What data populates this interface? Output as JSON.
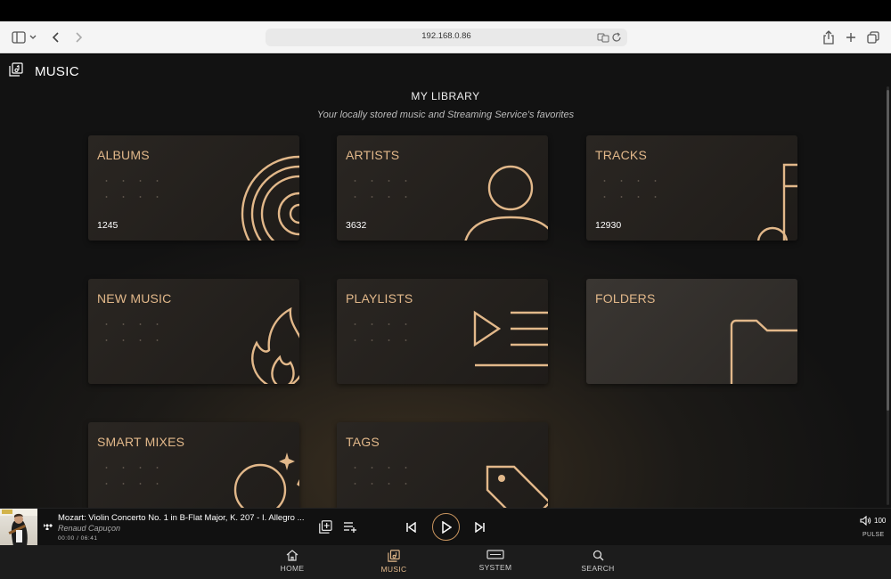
{
  "browser": {
    "url": "192.168.0.86",
    "icons": [
      "sidebar-icon",
      "chevron-down-icon",
      "back-icon",
      "forward-icon",
      "translate-icon",
      "reload-icon",
      "share-icon",
      "new-tab-icon",
      "tabs-icon"
    ]
  },
  "header": {
    "title": "MUSIC",
    "icon": "music-library-icon"
  },
  "library": {
    "title": "MY LIBRARY",
    "subtitle": "Your locally stored music and Streaming Service's favorites",
    "cards": [
      {
        "label": "ALBUMS",
        "count": "1245",
        "icon": "vinyl-icon"
      },
      {
        "label": "ARTISTS",
        "count": "3632",
        "icon": "person-icon"
      },
      {
        "label": "TRACKS",
        "count": "12930",
        "icon": "music-note-icon"
      },
      {
        "label": "NEW MUSIC",
        "count": "",
        "icon": "flame-icon"
      },
      {
        "label": "PLAYLISTS",
        "count": "",
        "icon": "playlist-icon"
      },
      {
        "label": "FOLDERS",
        "count": "",
        "icon": "folder-icon"
      },
      {
        "label": "SMART MIXES",
        "count": "",
        "icon": "sparkle-icon"
      },
      {
        "label": "TAGS",
        "count": "",
        "icon": "tag-icon"
      }
    ]
  },
  "player": {
    "title": "Mozart: Violin Concerto No. 1 in B-Flat Major, K. 207 - I. Allegro ...",
    "artist": "Renaud Capuçon",
    "time": "00:00 / 06:41",
    "progress": 0,
    "volume": "100",
    "output": "PULSE"
  },
  "nav": {
    "items": [
      {
        "label": "HOME",
        "icon": "home-icon"
      },
      {
        "label": "MUSIC",
        "icon": "music-library-icon"
      },
      {
        "label": "SYSTEM",
        "icon": "system-icon"
      },
      {
        "label": "SEARCH",
        "icon": "search-icon"
      }
    ],
    "active": "MUSIC"
  },
  "colors": {
    "accent": "#e2b88a",
    "background": "#121212",
    "card": "#2a2622"
  }
}
